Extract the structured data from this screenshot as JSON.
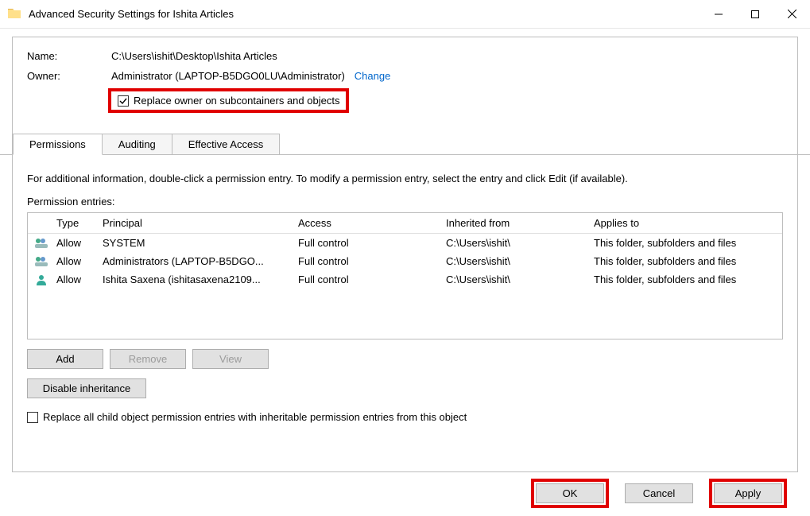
{
  "title": "Advanced Security Settings for Ishita Articles",
  "name_label": "Name:",
  "name_value": "C:\\Users\\ishit\\Desktop\\Ishita Articles",
  "owner_label": "Owner:",
  "owner_value": "Administrator (LAPTOP-B5DGO0LU\\Administrator)",
  "change_link": "Change",
  "replace_owner_label": "Replace owner on subcontainers and objects",
  "tabs": {
    "permissions": "Permissions",
    "auditing": "Auditing",
    "effective": "Effective Access"
  },
  "info_text": "For additional information, double-click a permission entry. To modify a permission entry, select the entry and click Edit (if available).",
  "entries_label": "Permission entries:",
  "headers": {
    "type": "Type",
    "principal": "Principal",
    "access": "Access",
    "inherited": "Inherited from",
    "applies": "Applies to"
  },
  "rows": [
    {
      "type": "Allow",
      "principal": "SYSTEM",
      "access": "Full control",
      "inherited": "C:\\Users\\ishit\\",
      "applies": "This folder, subfolders and files",
      "icon": "group"
    },
    {
      "type": "Allow",
      "principal": "Administrators (LAPTOP-B5DGO...",
      "access": "Full control",
      "inherited": "C:\\Users\\ishit\\",
      "applies": "This folder, subfolders and files",
      "icon": "group"
    },
    {
      "type": "Allow",
      "principal": "Ishita Saxena (ishitasaxena2109...",
      "access": "Full control",
      "inherited": "C:\\Users\\ishit\\",
      "applies": "This folder, subfolders and files",
      "icon": "user"
    }
  ],
  "buttons": {
    "add": "Add",
    "remove": "Remove",
    "view": "View",
    "disable_inh": "Disable inheritance"
  },
  "replace_all_label": "Replace all child object permission entries with inheritable permission entries from this object",
  "footer": {
    "ok": "OK",
    "cancel": "Cancel",
    "apply": "Apply"
  }
}
